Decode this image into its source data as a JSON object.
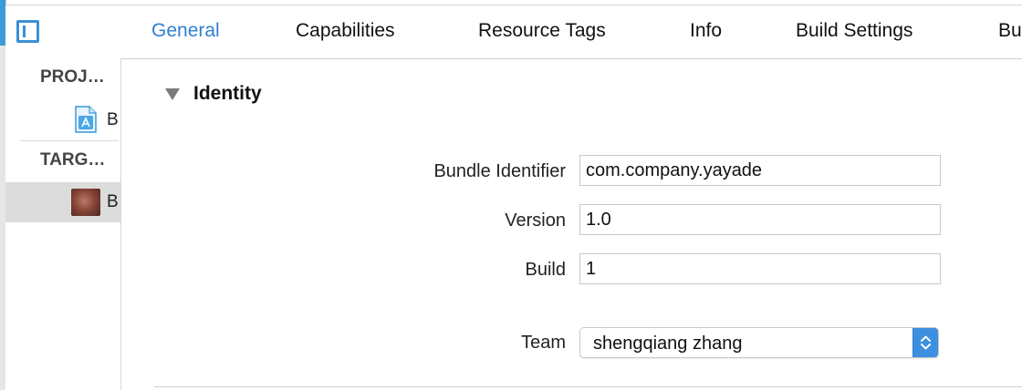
{
  "tabs": [
    {
      "label": "General",
      "active": true
    },
    {
      "label": "Capabilities",
      "active": false
    },
    {
      "label": "Resource Tags",
      "active": false
    },
    {
      "label": "Info",
      "active": false
    },
    {
      "label": "Build Settings",
      "active": false
    },
    {
      "label": "Bu",
      "active": false
    }
  ],
  "sidebar": {
    "project_header": "PROJ…",
    "project_item": {
      "label": "B",
      "icon": "app-project-icon"
    },
    "targets_header": "TARG…",
    "target_item": {
      "label": "B",
      "icon": "app-target-thumbnail",
      "selected": true
    }
  },
  "identity": {
    "section_title": "Identity",
    "bundle_identifier_label": "Bundle Identifier",
    "bundle_identifier_value": "com.company.yayade",
    "version_label": "Version",
    "version_value": "1.0",
    "build_label": "Build",
    "build_value": "1",
    "team_label": "Team",
    "team_value": "shengqiang zhang"
  },
  "colors": {
    "accent": "#2f7fd0",
    "select_stepper": "#3d8fe0",
    "sidebar_selected": "#dcdcdc"
  }
}
